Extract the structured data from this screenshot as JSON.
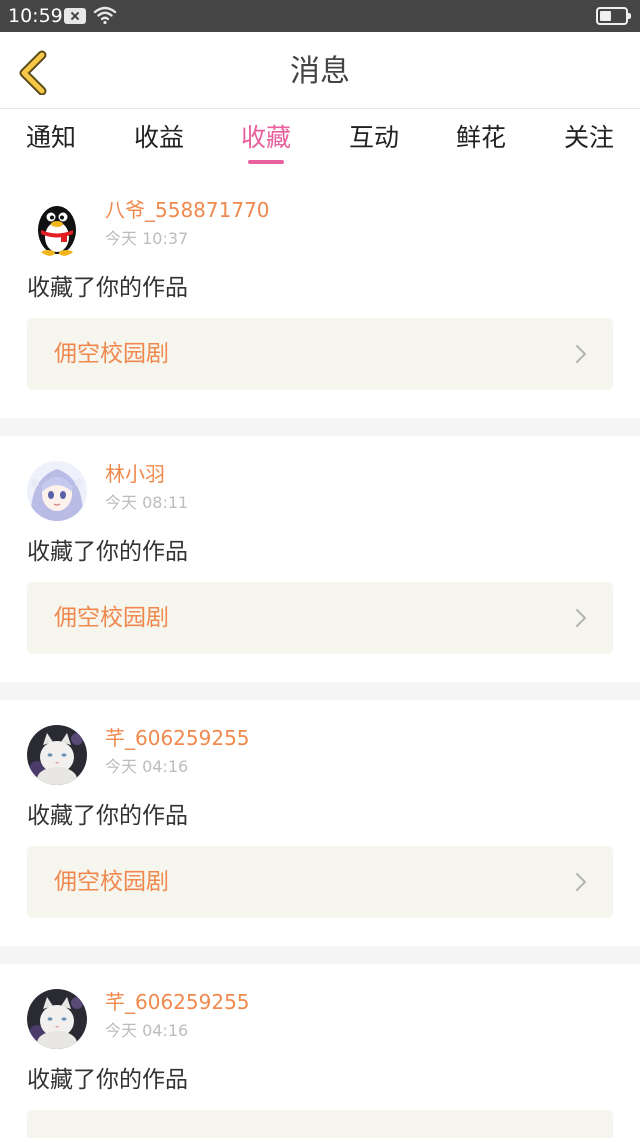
{
  "status_bar": {
    "time": "10:59",
    "icons": [
      "notification-x-icon",
      "wifi-icon",
      "battery-icon"
    ],
    "battery_level": 0.45
  },
  "header": {
    "title": "消息",
    "back_icon": "chevron-left-icon"
  },
  "tabs": [
    {
      "label": "通知",
      "active": false
    },
    {
      "label": "收益",
      "active": false
    },
    {
      "label": "收藏",
      "active": true
    },
    {
      "label": "互动",
      "active": false
    },
    {
      "label": "鲜花",
      "active": false
    },
    {
      "label": "关注",
      "active": false
    }
  ],
  "messages": [
    {
      "username": "八爷_558871770",
      "time": "今天 10:37",
      "action": "收藏了你的作品",
      "work_title": "佣空校园剧",
      "avatar": "qq-penguin-avatar"
    },
    {
      "username": "林小羽",
      "time": "今天 08:11",
      "action": "收藏了你的作品",
      "work_title": "佣空校园剧",
      "avatar": "anime-girl-avatar"
    },
    {
      "username": "芊_606259255",
      "time": "今天 04:16",
      "action": "收藏了你的作品",
      "work_title": "佣空校园剧",
      "avatar": "white-cat-avatar"
    },
    {
      "username": "芊_606259255",
      "time": "今天 04:16",
      "action": "收藏了你的作品",
      "work_title": "",
      "avatar": "white-cat-avatar"
    }
  ],
  "colors": {
    "accent_pink": "#e8609e",
    "username_orange": "#f0894d",
    "work_card_bg": "#f6f5ee",
    "status_bar_bg": "#454545",
    "back_arrow": "#f7c948"
  }
}
